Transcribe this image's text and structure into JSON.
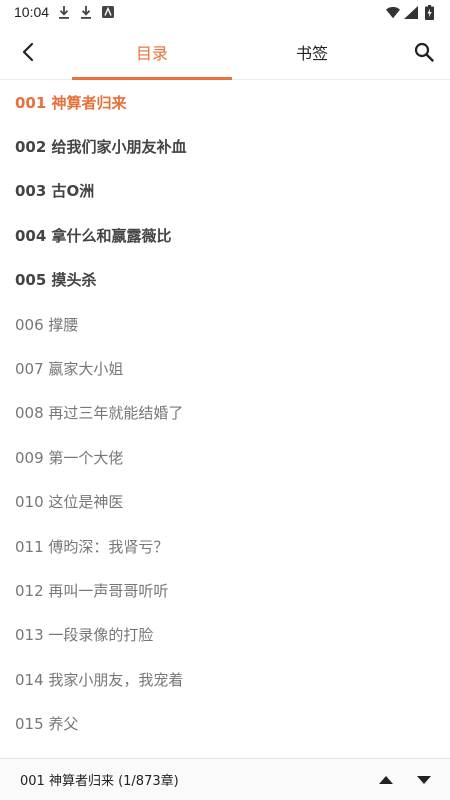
{
  "status_bar": {
    "time": "10:04"
  },
  "header": {
    "tabs": [
      {
        "label": "目录",
        "active": true
      },
      {
        "label": "书签",
        "active": false
      }
    ],
    "accent_color": "#e8703a"
  },
  "chapters": [
    {
      "label": "001 神算者归来",
      "style": "current"
    },
    {
      "label": "002 给我们家小朋友补血",
      "style": "bold"
    },
    {
      "label": "003 古O洲",
      "style": "bold"
    },
    {
      "label": "004 拿什么和嬴露薇比",
      "style": "bold"
    },
    {
      "label": "005 摸头杀",
      "style": "bold"
    },
    {
      "label": "006 撑腰",
      "style": "normal"
    },
    {
      "label": "007 嬴家大小姐",
      "style": "normal"
    },
    {
      "label": "008 再过三年就能结婚了",
      "style": "normal"
    },
    {
      "label": "009 第一个大佬",
      "style": "normal"
    },
    {
      "label": "010 这位是神医",
      "style": "normal"
    },
    {
      "label": "011 傅昀深：我肾亏？",
      "style": "normal"
    },
    {
      "label": "012 再叫一声哥哥听听",
      "style": "normal"
    },
    {
      "label": "013 一段录像的打脸",
      "style": "normal"
    },
    {
      "label": "014 我家小朋友，我宠着",
      "style": "normal"
    },
    {
      "label": "015 养父",
      "style": "normal"
    }
  ],
  "footer": {
    "progress": "001 神算者归来 (1/873章)"
  }
}
